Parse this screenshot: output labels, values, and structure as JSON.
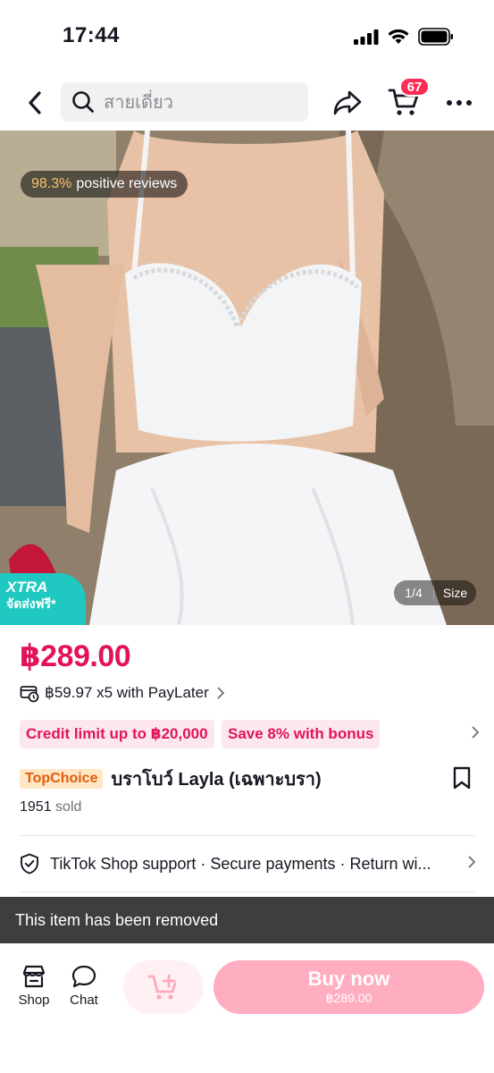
{
  "status_bar": {
    "time": "17:44",
    "icons": [
      "signal-icon",
      "wifi-icon",
      "battery-icon"
    ]
  },
  "nav": {
    "back_icon": "chevron-left-icon",
    "search_placeholder": "สายเดี่ยว",
    "share_icon": "share-icon",
    "cart_icon": "cart-icon",
    "cart_count": "67",
    "more_icon": "more-icon"
  },
  "gallery": {
    "review_percent": "98.3%",
    "review_text": "positive reviews",
    "xtra_title": "XTRA",
    "xtra_subtitle": "จัดส่งฟรี*",
    "index": "1/4",
    "size_label": "Size"
  },
  "product": {
    "price": "฿289.00",
    "paylater": "฿59.97 x5 with PayLater",
    "promos": [
      "Credit limit up to ฿20,000",
      "Save 8% with bonus"
    ],
    "badge": "TopChoice",
    "title": "บราโบว์ Layla (เฉพาะบรา)",
    "sold_count": "1951",
    "sold_label": "sold",
    "support": "TikTok Shop support · Secure payments · Return wi..."
  },
  "toast": {
    "message": "This item has been removed"
  },
  "bottom_bar": {
    "shop_label": "Shop",
    "chat_label": "Chat",
    "buy_label": "Buy now",
    "buy_price": "฿289.00"
  },
  "colors": {
    "accent": "#e2135a",
    "badge": "#fe2c55",
    "buy_button": "#ffadc0",
    "xtra": "#1fc9c2",
    "toast": "#3e3e3e"
  }
}
